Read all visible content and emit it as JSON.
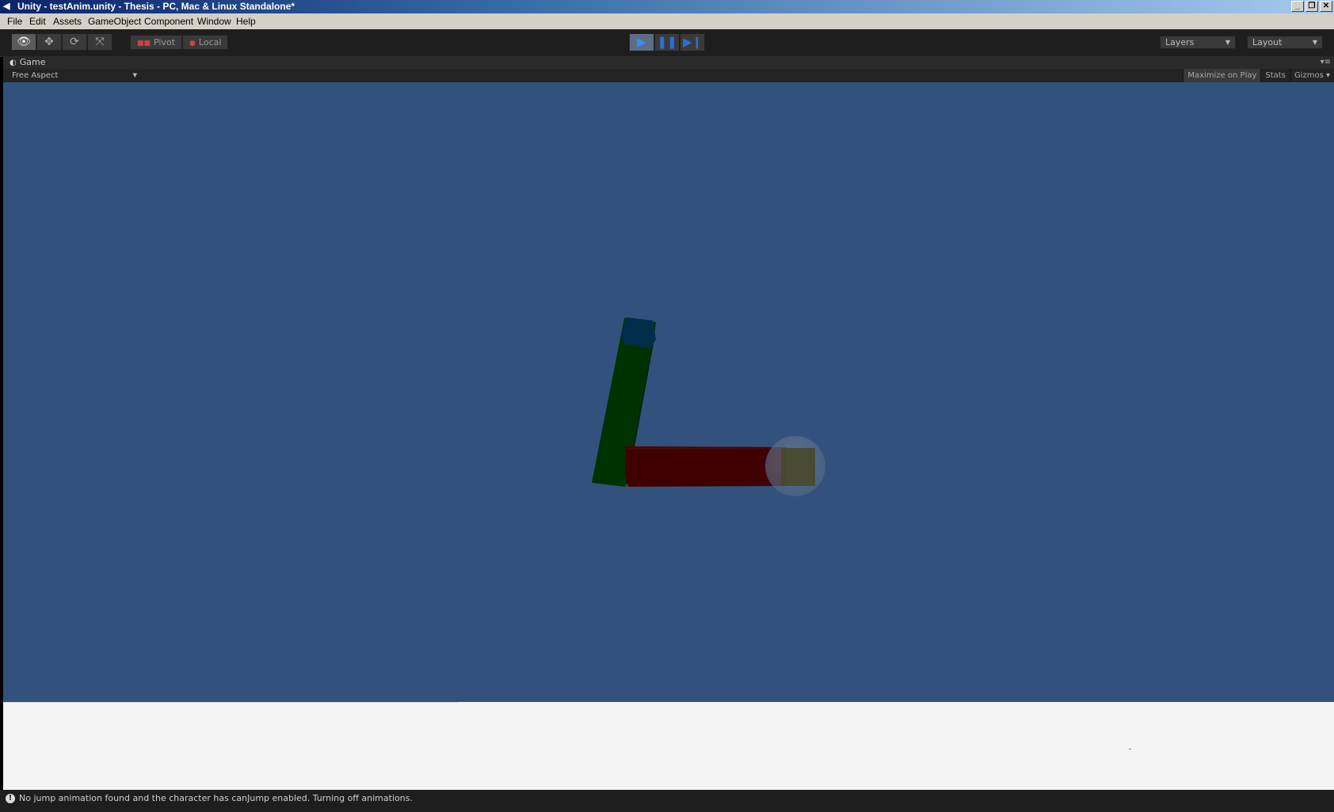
{
  "window": {
    "title": "Unity - testAnim.unity - Thesis - PC, Mac & Linux Standalone*",
    "app_icon": "unity-icon",
    "controls": [
      "minimize",
      "restore",
      "close"
    ]
  },
  "menu": {
    "items": [
      "File",
      "Edit",
      "Assets",
      "GameObject",
      "Component",
      "Window",
      "Help"
    ]
  },
  "toolbar": {
    "tools": [
      "view-tool-icon",
      "move-tool-icon",
      "rotate-tool-icon",
      "scale-tool-icon"
    ],
    "active_tool": "view-tool-icon",
    "pivot_label": "Pivot",
    "local_label": "Local",
    "play_controls": [
      "play-icon",
      "pause-icon",
      "step-icon"
    ],
    "playing": true,
    "layers_label": "Layers",
    "layout_label": "Layout"
  },
  "game_view": {
    "tab_label": "Game",
    "aspect_label": "Free Aspect",
    "maximize_label": "Maximize on Play",
    "stats_label": "Stats",
    "gizmos_label": "Gizmos",
    "colors": {
      "background": "#32527d",
      "upper_arm": "#003200",
      "upper_arm_cap": "#002e4a",
      "forearm": "#3e0000",
      "joint_sphere": "#6f7f96"
    }
  },
  "status": {
    "message": "No jump animation found and the character has canJump enabled. Turning off animations."
  }
}
